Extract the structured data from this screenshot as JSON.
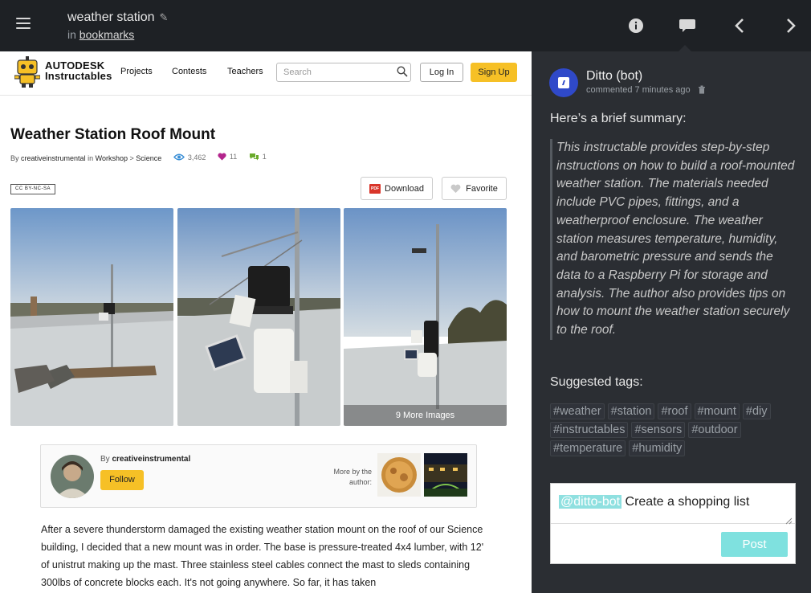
{
  "topbar": {
    "title": "weather station",
    "sub_prefix": "in",
    "sub_link": "bookmarks"
  },
  "site": {
    "logo_line1": "AUTODESK",
    "logo_line2": "Instructables",
    "nav": [
      "Projects",
      "Contests",
      "Teachers"
    ],
    "search_placeholder": "Search",
    "login": "Log In",
    "signup": "Sign Up"
  },
  "article": {
    "title": "Weather Station Roof Mount",
    "by": "By",
    "author": "creativeinstrumental",
    "in": "in",
    "category": "Workshop",
    "sep": ">",
    "subcategory": "Science",
    "views": "3,462",
    "favorites": "11",
    "comments": "1",
    "license": "CC BY-NC-SA",
    "download": "Download",
    "favorite": "Favorite",
    "more_images": "9 More Images",
    "card_by": "By",
    "card_author": "creativeinstrumental",
    "follow": "Follow",
    "more_by": "More by the author:",
    "body": "After a severe thunderstorm damaged the existing weather station mount on the roof of our Science building, I decided that a new mount was in order. The base is pressure-treated 4x4 lumber, with 12' of unistrut making up the mast. Three stainless steel cables connect the mast to sleds containing 300lbs of concrete blocks each. It's not going anywhere. So far, it has taken"
  },
  "panel": {
    "bot_name": "Ditto (bot)",
    "bot_meta": "commented 7 minutes ago",
    "summary_heading": "Here’s a brief summary:",
    "summary": "This instructable provides step-by-step instructions on how to build a roof-mounted weather station. The materials needed include PVC pipes, fittings, and a weatherproof enclosure. The weather station measures temperature, humidity, and barometric pressure and sends the data to a Raspberry Pi for storage and analysis. The author also provides tips on how to mount the weather station securely to the roof.",
    "tags_heading": "Suggested tags:",
    "tags": [
      "#weather",
      "#station",
      "#roof",
      "#mount",
      "#diy",
      "#instructables",
      "#sensors",
      "#outdoor",
      "#temperature",
      "#humidity"
    ],
    "mention": "@ditto-bot",
    "input_text": " Create a shopping list",
    "post": "Post"
  },
  "colors": {
    "accent_yellow": "#f6c026",
    "post_teal": "#7fe1df",
    "bot_blue": "#2f49c9"
  }
}
